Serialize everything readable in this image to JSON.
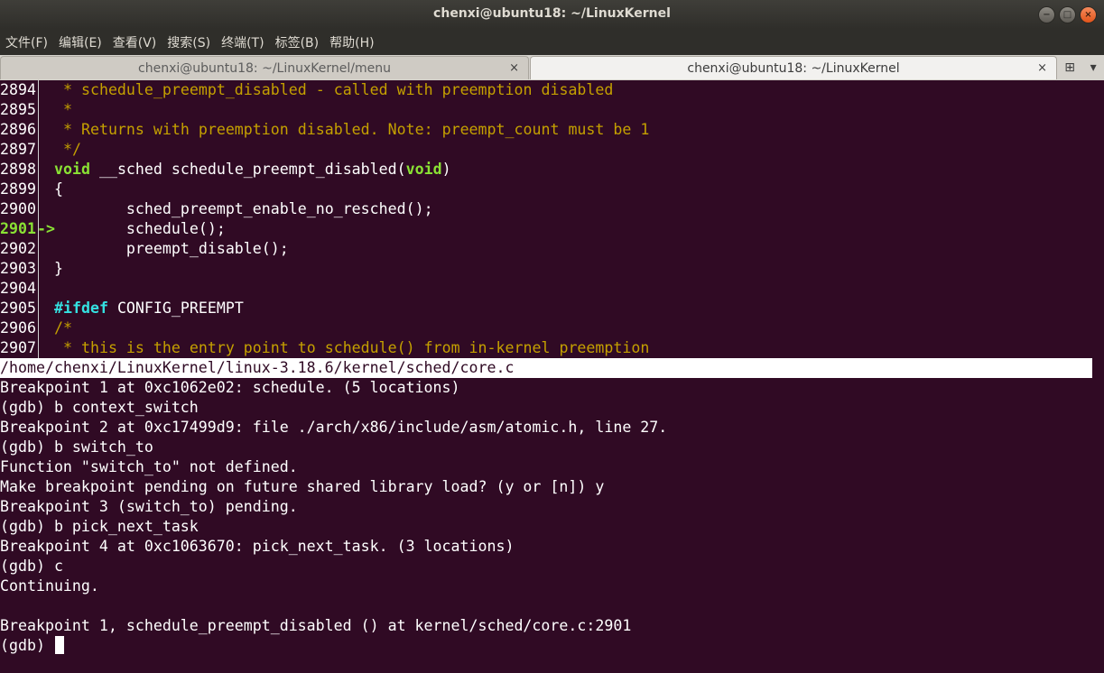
{
  "window": {
    "title": "chenxi@ubuntu18: ~/LinuxKernel",
    "minimize_symbol": "−",
    "maximize_symbol": "□",
    "close_symbol": "×"
  },
  "menu": {
    "items": [
      "文件(F)",
      "编辑(E)",
      "查看(V)",
      "搜索(S)",
      "终端(T)",
      "标签(B)",
      "帮助(H)"
    ]
  },
  "tabs": [
    {
      "label": "chenxi@ubuntu18: ~/LinuxKernel/menu",
      "close": "×",
      "active": false
    },
    {
      "label": "chenxi@ubuntu18: ~/LinuxKernel",
      "close": "×",
      "active": true
    }
  ],
  "tab_extra": {
    "new_tab_icon": "⊞",
    "scroll_icon": "▾"
  },
  "source": {
    "lines": [
      {
        "num": "2894",
        "mark": "",
        "text": " * schedule_preempt_disabled - called with preemption disabled"
      },
      {
        "num": "2895",
        "mark": "",
        "text": " *"
      },
      {
        "num": "2896",
        "mark": "",
        "text": " * Returns with preemption disabled. Note: preempt_count must be 1"
      },
      {
        "num": "2897",
        "mark": "",
        "text": " */"
      },
      {
        "num": "2898",
        "mark": "",
        "kw1": "void",
        "mid": " __sched schedule_preempt_disabled(",
        "kw2": "void",
        "end": ")"
      },
      {
        "num": "2899",
        "mark": "",
        "text": "{"
      },
      {
        "num": "2900",
        "mark": "",
        "text": "        sched_preempt_enable_no_resched();"
      },
      {
        "num": "2901",
        "mark": "->",
        "text": "        schedule();"
      },
      {
        "num": "2902",
        "mark": "",
        "text": "        preempt_disable();"
      },
      {
        "num": "2903",
        "mark": "",
        "text": "}"
      },
      {
        "num": "2904",
        "mark": "",
        "text": ""
      },
      {
        "num": "2905",
        "mark": "",
        "pp": "#ifdef",
        "rest": " CONFIG_PREEMPT"
      },
      {
        "num": "2906",
        "mark": "",
        "text": "/*"
      },
      {
        "num": "2907",
        "mark": "",
        "text": " * this is the entry point to schedule() from in-kernel preemption"
      }
    ],
    "current_line": "2901"
  },
  "status_path": "/home/chenxi/LinuxKernel/linux-3.18.6/kernel/sched/core.c",
  "gdb_output": [
    "Breakpoint 1 at 0xc1062e02: schedule. (5 locations)",
    "(gdb) b context_switch",
    "Breakpoint 2 at 0xc17499d9: file ./arch/x86/include/asm/atomic.h, line 27.",
    "(gdb) b switch_to",
    "Function \"switch_to\" not defined.",
    "Make breakpoint pending on future shared library load? (y or [n]) y",
    "Breakpoint 3 (switch_to) pending.",
    "(gdb) b pick_next_task",
    "Breakpoint 4 at 0xc1063670: pick_next_task. (3 locations)",
    "(gdb) c",
    "Continuing.",
    "",
    "Breakpoint 1, schedule_preempt_disabled () at kernel/sched/core.c:2901"
  ],
  "prompt": "(gdb) ",
  "colors": {
    "terminal_bg": "#300a24",
    "comment": "#c4a000",
    "keyword": "#8ae234",
    "preprocessor": "#34e2e2"
  }
}
